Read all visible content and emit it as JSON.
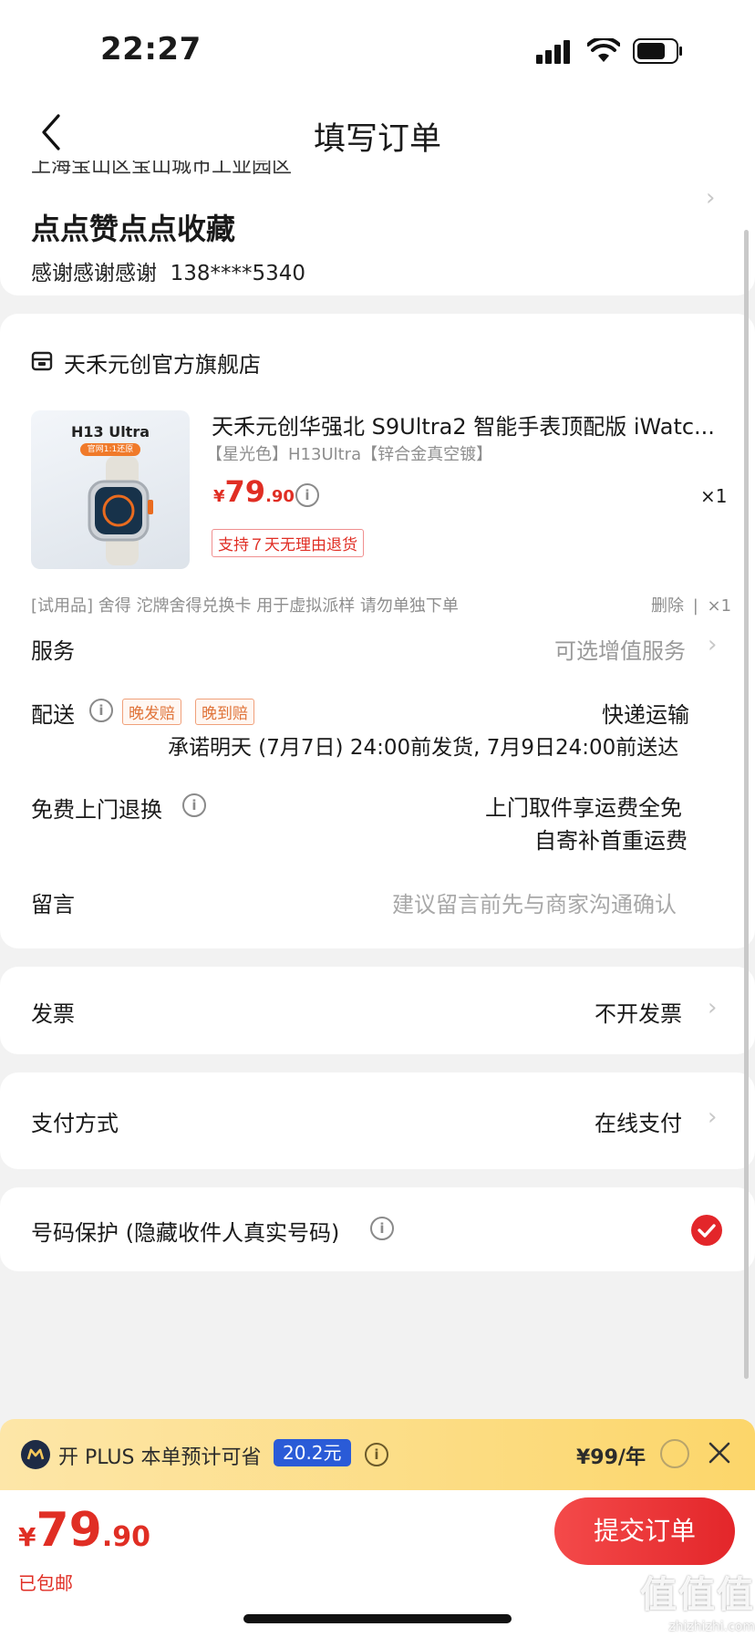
{
  "status": {
    "time": "22:27"
  },
  "nav": {
    "title": "填写订单"
  },
  "address": {
    "line": "上海宝山区宝山城市工业园区",
    "name": "点点赞点点收藏",
    "contact": "感谢感谢感谢  138****5340"
  },
  "store": {
    "name": "天禾元创官方旗舰店"
  },
  "product": {
    "thumb_title": "H13 Ultra",
    "thumb_badge": "官网1:1还原",
    "title": "天禾元创华强北 S9Ultra2 智能手表顶配版 iWatc...",
    "spec": "【星光色】H13Ultra【锌合金真空镀】",
    "price_symbol": "¥",
    "price_int": "79",
    "price_dec": ".90",
    "qty": "×1",
    "return_tag": "支持７天无理由退货"
  },
  "trial": {
    "text": "[试用品] 舍得 沱牌舍得兑换卡 用于虚拟派样 请勿单独下单",
    "delete": "删除",
    "sep": "|",
    "qty": "×1"
  },
  "service": {
    "label": "服务",
    "value": "可选增值服务"
  },
  "delivery": {
    "label": "配送",
    "tag1": "晚发赔",
    "tag2": "晚到赔",
    "method": "快递运输",
    "promise": "承诺明天 (7月7日) 24:00前发货, 7月9日24:00前送达"
  },
  "free_return": {
    "label": "免费上门退换",
    "line1": "上门取件享运费全免",
    "line2": "自寄补首重运费"
  },
  "message": {
    "label": "留言",
    "placeholder": "建议留言前先与商家沟通确认"
  },
  "invoice": {
    "label": "发票",
    "value": "不开发票"
  },
  "payment": {
    "label": "支付方式",
    "value": "在线支付"
  },
  "privacy": {
    "label": "号码保护 (隐藏收件人真实号码)",
    "checked": true
  },
  "plus": {
    "text": "开 PLUS 本单预计可省",
    "save": "20.2元",
    "price": "¥99/年"
  },
  "total": {
    "symbol": "¥",
    "int": "79",
    "dec": ".90",
    "shipping": "已包邮"
  },
  "submit": {
    "label": "提交订单"
  },
  "watermark": {
    "mark": "值值值",
    "url": "zhizhizhi.com"
  },
  "colors": {
    "accent": "#e02e24",
    "plus_bg": "#fcd66a",
    "plus_badge": "#2a5bd7"
  }
}
